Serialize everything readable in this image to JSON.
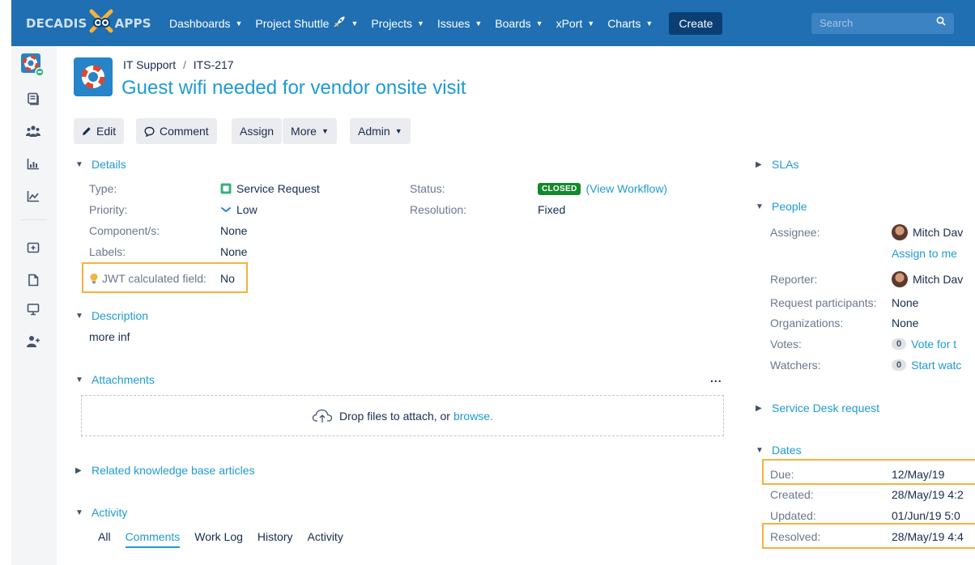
{
  "nav": {
    "logo_left": "DECADIS",
    "logo_right": "APPS",
    "items": [
      {
        "label": "Dashboards"
      },
      {
        "label": "Project Shuttle"
      },
      {
        "label": "Projects"
      },
      {
        "label": "Issues"
      },
      {
        "label": "Boards"
      },
      {
        "label": "xPort"
      },
      {
        "label": "Charts"
      }
    ],
    "create_label": "Create",
    "search_placeholder": "Search"
  },
  "sidebar": {
    "icons": [
      "project-avatar-icon",
      "issues-icon",
      "people-icon",
      "reports-icon",
      "chart-icon",
      "add-icon",
      "page-icon",
      "monitor-icon",
      "add-user-icon"
    ]
  },
  "issue": {
    "project": "IT Support",
    "separator": "/",
    "key": "ITS-217",
    "title": "Guest wifi needed for vendor onsite visit"
  },
  "toolbar": {
    "edit": "Edit",
    "comment": "Comment",
    "assign": "Assign",
    "more": "More",
    "admin": "Admin"
  },
  "details": {
    "heading": "Details",
    "type_label": "Type:",
    "type_value": "Service Request",
    "priority_label": "Priority:",
    "priority_value": "Low",
    "components_label": "Component/s:",
    "components_value": "None",
    "labels_label": "Labels:",
    "labels_value": "None",
    "jwt_label": "JWT calculated field:",
    "jwt_value": "No",
    "status_label": "Status:",
    "status_value": "CLOSED",
    "view_workflow": "(View Workflow)",
    "resolution_label": "Resolution:",
    "resolution_value": "Fixed"
  },
  "description": {
    "heading": "Description",
    "text": "more inf"
  },
  "attachments": {
    "heading": "Attachments",
    "more": "...",
    "drop_text": "Drop files to attach, or",
    "browse": "browse."
  },
  "kb": {
    "heading": "Related knowledge base articles"
  },
  "activity": {
    "heading": "Activity",
    "tabs": [
      "All",
      "Comments",
      "Work Log",
      "History",
      "Activity"
    ]
  },
  "right": {
    "slas": "SLAs",
    "people_heading": "People",
    "assignee_label": "Assignee:",
    "assignee_value": "Mitch Dav",
    "assign_to_me": "Assign to me",
    "reporter_label": "Reporter:",
    "reporter_value": "Mitch Dav",
    "participants_label": "Request participants:",
    "participants_value": "None",
    "orgs_label": "Organizations:",
    "orgs_value": "None",
    "votes_label": "Votes:",
    "votes_count": "0",
    "votes_link": "Vote for t",
    "watchers_label": "Watchers:",
    "watchers_count": "0",
    "watchers_link": "Start watc",
    "sd_heading": "Service Desk request",
    "dates_heading": "Dates",
    "due_label": "Due:",
    "due_value": "12/May/19",
    "created_label": "Created:",
    "created_value": "28/May/19 4:2",
    "updated_label": "Updated:",
    "updated_value": "01/Jun/19 5:0",
    "resolved_label": "Resolved:",
    "resolved_value": "28/May/19 4:4"
  },
  "colors": {
    "topbar": "#1f6fb2",
    "link": "#1e9bd2",
    "highlight": "#f6b23d",
    "closed": "#14892c"
  }
}
